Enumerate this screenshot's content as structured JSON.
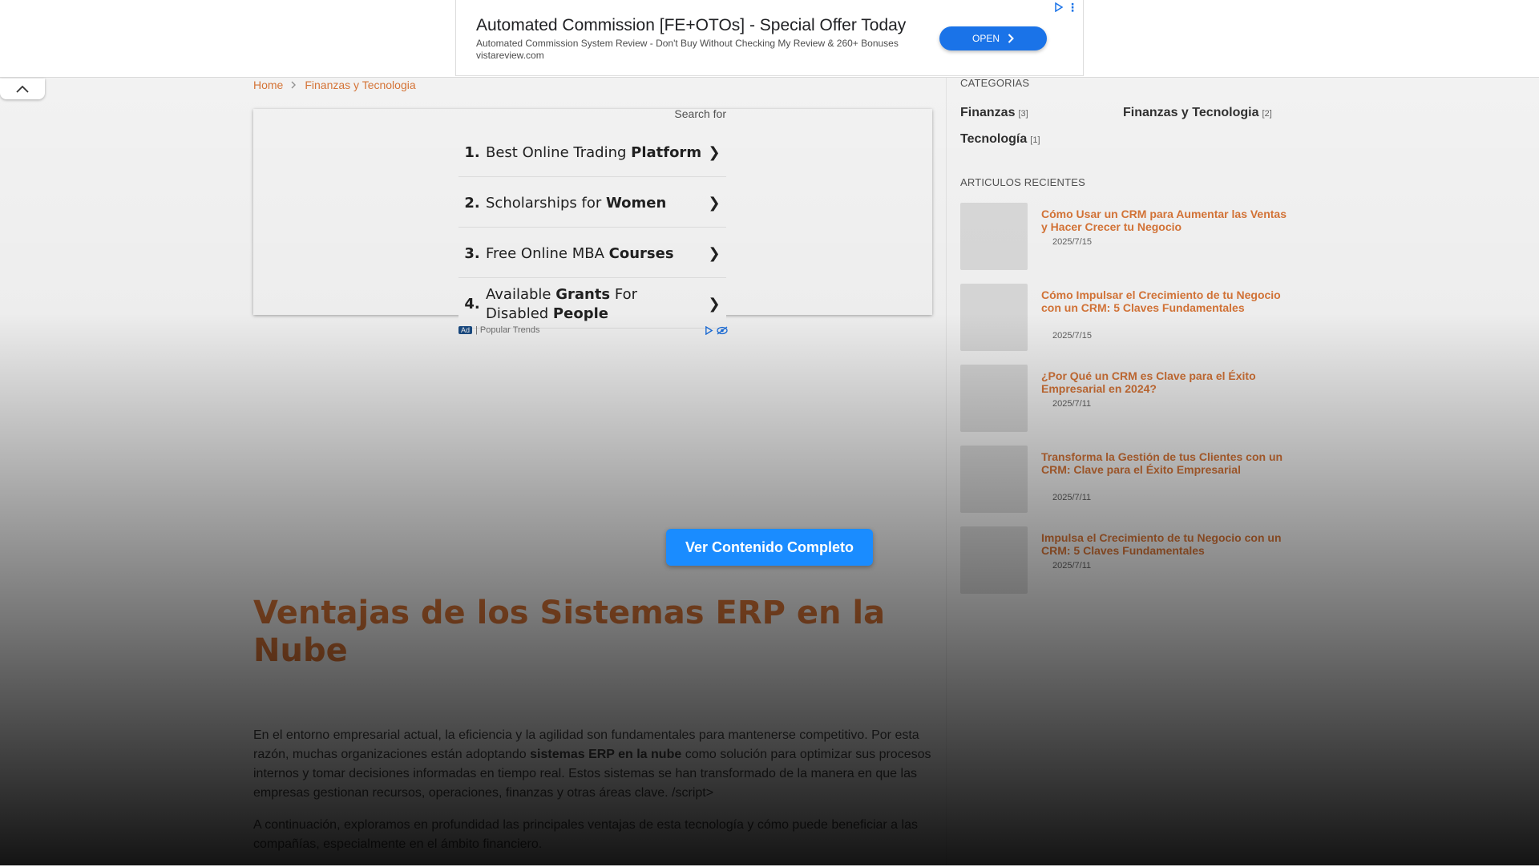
{
  "top_ad": {
    "title": "Automated Commission [FE+OTOs] - Special Offer Today",
    "description": "Automated Commission System Review - Don't Buy Without Checking My Review & 260+ Bonuses",
    "url": "vistareview.com",
    "open_label": "OPEN",
    "adchoices_icon": "play-triangle-icon",
    "menu_icon": "vertical-dots-icon"
  },
  "breadcrumb": {
    "home": "Home",
    "category": "Finanzas y Tecnologia"
  },
  "search_ad": {
    "header": "Search for",
    "items": [
      {
        "num": "1.",
        "pre": "Best Online Trading ",
        "bold": "Platform",
        "post": ""
      },
      {
        "num": "2.",
        "pre": "Scholarships for ",
        "bold": "Women",
        "post": ""
      },
      {
        "num": "3.",
        "pre": "Free Online MBA ",
        "bold": "Courses",
        "post": ""
      },
      {
        "num": "4.",
        "pre": "Available ",
        "bold": "Grants",
        "post": " For Disabled ",
        "bold2": "People"
      }
    ],
    "arrow": "❯",
    "ad_badge": "Ad",
    "footer": "| Popular Trends"
  },
  "article": {
    "title": "Ventajas de los Sistemas ERP en la Nube",
    "p1_pre": " En el entorno empresarial actual, la eficiencia y la agilidad son fundamentales para mantenerse competitivo. Por esta razón, muchas organizaciones están adoptando ",
    "p1_bold": "sistemas ERP en la nube",
    "p1_post": " como solución para optimizar sus procesos internos y tomar decisiones informadas en tiempo real. Estos sistemas se han transformado de la manera en que las empresas gestionan recursos, operaciones, finanzas y otras áreas clave. /script>",
    "p2": "A continuación, exploramos en profundidad las principales ventajas de esta tecnología y cómo puede beneficiar a las compañías, especialmente en el ámbito financiero."
  },
  "cta": {
    "label": "Ver Contenido Completo"
  },
  "sidebar": {
    "categories_heading": "CATEGORIAS",
    "categories": [
      {
        "name": "Finanzas",
        "count": "[3]"
      },
      {
        "name": "Finanzas y Tecnologia",
        "count": "[2]"
      },
      {
        "name": "Tecnología",
        "count": "[1]"
      }
    ],
    "recent_heading": "ARTICULOS RECIENTES",
    "recent": [
      {
        "title": "Cómo Usar un CRM para Aumentar las Ventas y Hacer Crecer tu Negocio",
        "date": "2025/7/15"
      },
      {
        "title": "Cómo Impulsar el Crecimiento de tu Negocio con un CRM: 5 Claves Fundamentales",
        "date": "2025/7/15"
      },
      {
        "title": "¿Por Qué un CRM es Clave para el Éxito Empresarial en 2024?",
        "date": "2025/7/11"
      },
      {
        "title": "Transforma la Gestión de tus Clientes con un CRM: Clave para el Éxito Empresarial",
        "date": "2025/7/11"
      },
      {
        "title": "Impulsa el Crecimiento de tu Negocio con un CRM: 5 Claves Fundamentales",
        "date": "2025/7/11"
      }
    ]
  },
  "collapse_icon": "chevron-up-icon"
}
